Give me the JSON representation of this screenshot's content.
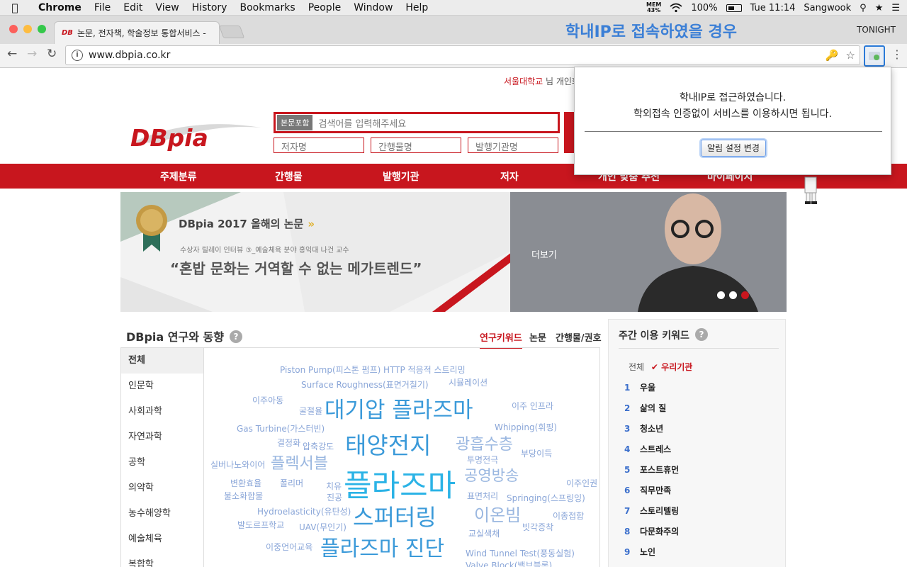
{
  "menubar": {
    "app": "Chrome",
    "items": [
      "File",
      "Edit",
      "View",
      "History",
      "Bookmarks",
      "People",
      "Window",
      "Help"
    ],
    "mem_label": "MEM",
    "mem_value": "43%",
    "battery": "100%",
    "clock": "Tue 11:14",
    "user": "Sangwook"
  },
  "browser": {
    "tab_title": "논문, 전자책, 학술정보 통합서비스 -",
    "tab_favicon": "DB",
    "overlay_caption": "학내IP로 접속하였을 경우",
    "profile": "TONIGHT",
    "url": "www.dbpia.co.kr"
  },
  "popup": {
    "line1": "학내IP로 접근하였습니다.",
    "line2": "학외접속 인증없이 서비스를 이용하시면 됩니다.",
    "button": "알림 설정 변경"
  },
  "header": {
    "institution": "서울대학교",
    "login_suffix": "님 개인화",
    "search_tag": "본문포함",
    "search_placeholder": "검색어를 입력해주세요",
    "field_author": "저자명",
    "field_journal": "간행물명",
    "field_publisher": "발행기관명"
  },
  "nav": [
    "주제분류",
    "간행물",
    "발행기관",
    "저자",
    "개인 맞춤 추천",
    "마이페이지"
  ],
  "banner": {
    "badge_title": "DBpia 2017 올해의 논문",
    "arrows": "»",
    "subtitle": "수상자 릴레이 인터뷰 ③_예술체육 분야 홍익대 나건 교수",
    "quote": "“혼밥 문화는 거역할 수 없는 메가트렌드”",
    "more": "더보기"
  },
  "research": {
    "title": "DBpia 연구와 동향",
    "help": "?",
    "tabs": [
      "연구키워드",
      "논문",
      "간행물/권호"
    ],
    "categories": [
      "전체",
      "인문학",
      "사회과학",
      "자연과학",
      "공학",
      "의약학",
      "농수해양학",
      "예술체육",
      "복합학"
    ],
    "cloud": [
      "Piston Pump(피스톤 펌프)",
      "HTTP 적응적 스트리밍",
      "Surface Roughness(표면거칠기)",
      "시뮬레이션",
      "이주아동",
      "굴절율",
      "대기압 플라즈마",
      "이주 인프라",
      "Gas Turbine(가스터빈)",
      "Whipping(휘핑)",
      "결정화",
      "압축강도",
      "태양전지",
      "광흡수층",
      "부당이득",
      "실버나노와이어",
      "플렉서블",
      "투명전극",
      "공영방송",
      "변환효율",
      "폴리머",
      "치유",
      "플라즈마",
      "이주인권",
      "불소화합물",
      "진공",
      "표면처리",
      "Springing(스프링잉)",
      "Hydroelasticity(유탄성)",
      "스퍼터링",
      "이온빔",
      "이종접합",
      "발도르프학교",
      "UAV(무인기)",
      "빗각증착",
      "교실색채",
      "이중언어교육",
      "플라즈마 진단",
      "Wind Tunnel Test(풍동실험)",
      "Valve Block(밸브블록)"
    ]
  },
  "weekly": {
    "title": "주간 이용 키워드",
    "help": "?",
    "filter_all": "전체",
    "filter_mine": "✔ 우리기관",
    "items": [
      {
        "rank": "1",
        "word": "우울"
      },
      {
        "rank": "2",
        "word": "삶의 질"
      },
      {
        "rank": "3",
        "word": "청소년"
      },
      {
        "rank": "4",
        "word": "스트레스"
      },
      {
        "rank": "5",
        "word": "포스트휴먼"
      },
      {
        "rank": "6",
        "word": "직무만족"
      },
      {
        "rank": "7",
        "word": "스토리텔링"
      },
      {
        "rank": "8",
        "word": "다문화주의"
      },
      {
        "rank": "9",
        "word": "노인"
      }
    ]
  },
  "colors": {
    "brand_red": "#c8161e",
    "cloud_blue": "#3b9ad9",
    "accent_blue": "#3b7fd6"
  }
}
